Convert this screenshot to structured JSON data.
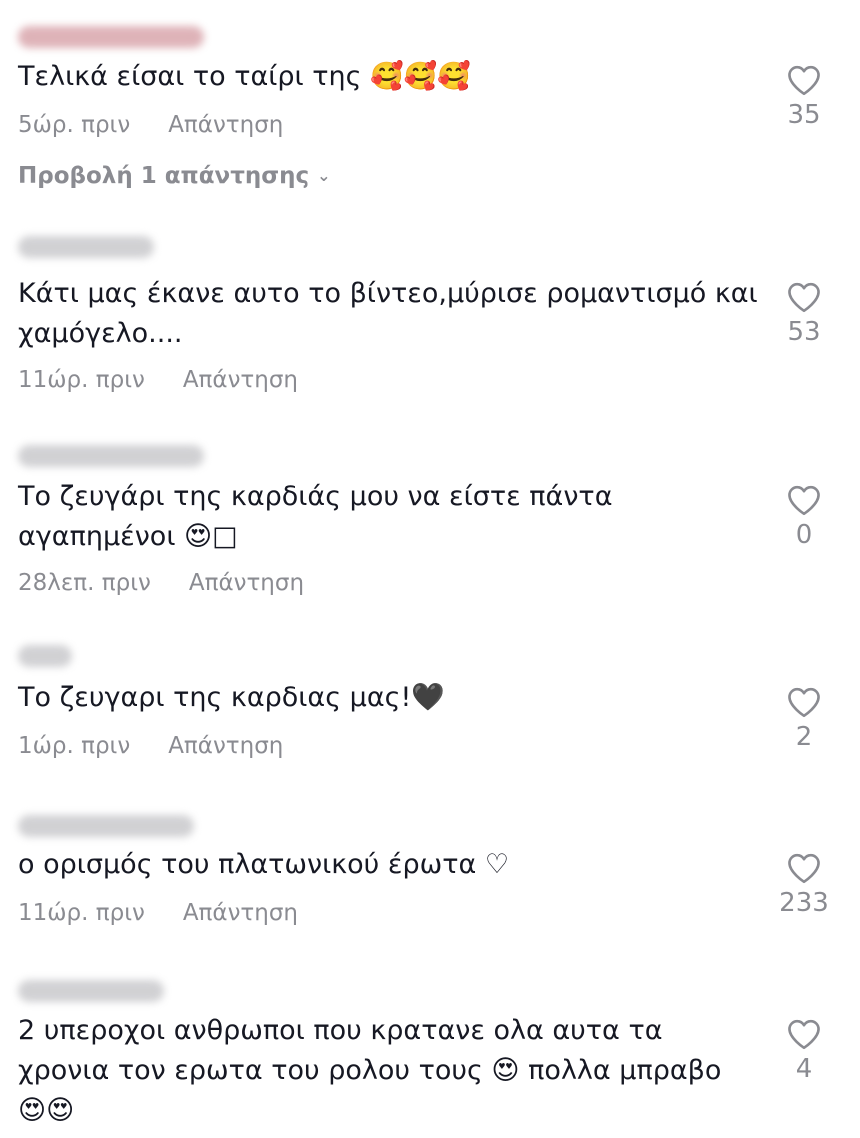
{
  "comments": [
    {
      "text": "Τελικά είσαι το ταίρι της 🥰🥰🥰",
      "time": "5ώρ. πριν",
      "reply": "Απάντηση",
      "likes": "35"
    },
    {
      "text": "Κάτι μας έκανε αυτο το βίντεο,μύρισε ρομαντισμό και χαμόγελο....",
      "time": "11ώρ. πριν",
      "reply": "Απάντηση",
      "likes": "53"
    },
    {
      "text": "Το ζευγάρι της καρδιάς μου να είστε πάντα αγαπημένοι 😍□",
      "time": "28λεπ. πριν",
      "reply": "Απάντηση",
      "likes": "0"
    },
    {
      "text": "Το ζευγαρι της καρδιας μας!🖤",
      "time": "1ώρ. πριν",
      "reply": "Απάντηση",
      "likes": "2"
    },
    {
      "text": "ο ορισμός του πλατωνικού έρωτα ♡",
      "time": "11ώρ. πριν",
      "reply": "Απάντηση",
      "likes": "233"
    },
    {
      "text": "2 υπεροχοι ανθρωποι που κρατανε ολα αυτα τα χρονια τον ερωτα του ρολου τους 😍 πολλα μπραβο 😍😍",
      "time": "",
      "reply": "",
      "likes": "4"
    }
  ],
  "view_replies": {
    "label": "Προβολή 1 απάντησης",
    "chevron": "⌄"
  },
  "colors": {
    "text": "#161823",
    "meta": "#8a8b91",
    "blur": "#c9c9cc"
  },
  "icons": {
    "like": "heart-outline-icon"
  }
}
